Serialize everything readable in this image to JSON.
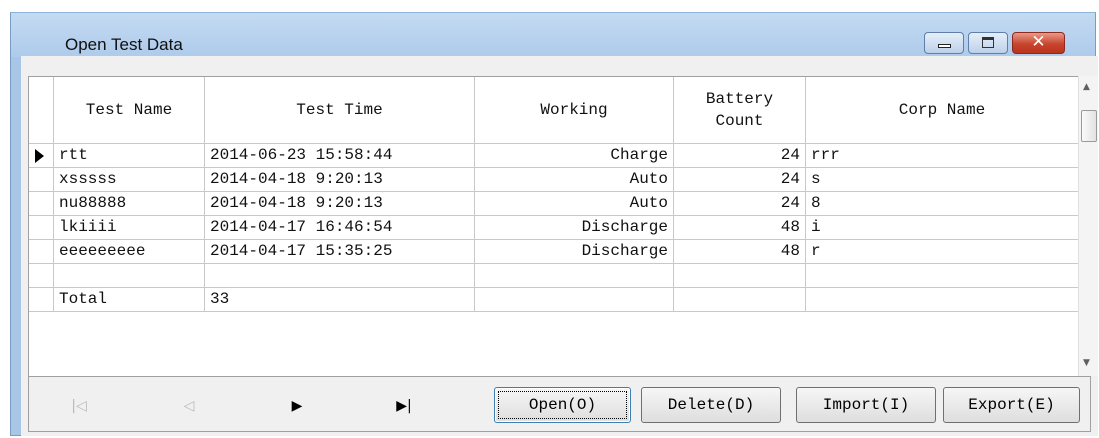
{
  "window": {
    "title": "Open Test Data",
    "controls": {
      "minimize": "minimize",
      "maximize": "maximize",
      "close": "close"
    }
  },
  "grid": {
    "columns": [
      "Test Name",
      "Test Time",
      "Working",
      "Battery\nCount",
      "Corp Name"
    ],
    "rows": [
      {
        "name": "rtt",
        "time": "2014-06-23 15:58:44",
        "working": "Charge",
        "count": "24",
        "corp": "rrr",
        "current": true
      },
      {
        "name": "xsssss",
        "time": "2014-04-18 9:20:13",
        "working": "Auto",
        "count": "24",
        "corp": "s"
      },
      {
        "name": "nu88888",
        "time": "2014-04-18 9:20:13",
        "working": "Auto",
        "count": "24",
        "corp": "8"
      },
      {
        "name": "lkiiii",
        "time": "2014-04-17 16:46:54",
        "working": "Discharge",
        "count": "48",
        "corp": "i"
      },
      {
        "name": "eeeeeeeee",
        "time": "2014-04-17 15:35:25",
        "working": "Discharge",
        "count": "48",
        "corp": "r"
      },
      {
        "name": "",
        "time": "",
        "working": "",
        "count": "",
        "corp": ""
      }
    ],
    "total": {
      "label": "Total",
      "value": "33"
    }
  },
  "navigator": {
    "first": "first-record-icon",
    "prior": "prior-record-icon",
    "next": "next-record-icon",
    "last": "last-record-icon"
  },
  "buttons": {
    "open": "Open(O)",
    "delete": "Delete(D)",
    "import": "Import(I)",
    "export": "Export(E)"
  },
  "colors": {
    "title_bar": "#a9c6e6",
    "close_button": "#c8452e",
    "face": "#f0f0f0"
  }
}
